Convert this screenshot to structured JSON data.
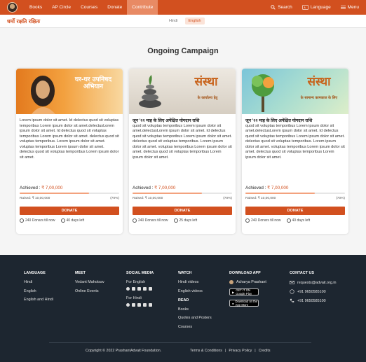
{
  "nav": {
    "items": [
      {
        "label": "Books"
      },
      {
        "label": "AP Circle"
      },
      {
        "label": "Courses"
      },
      {
        "label": "Donate"
      },
      {
        "label": "Contribute"
      }
    ],
    "search_label": "Search",
    "language_label": "Language",
    "menu_label": "Menu",
    "accent_color": "#d2501f"
  },
  "subbar": {
    "tagline": "धर्मो रक्षति रक्षितः",
    "lang_options": [
      "Hindi",
      "English"
    ],
    "selected": "English"
  },
  "page_title": "Ongoing Campaign",
  "cards": [
    {
      "banner_text": "घर-घर उपनिषद अभियान",
      "title": "",
      "desc": "Lorem ipsum dolor sit amet. Id delectus quod sit voluptas temporibus Lorem ipsum dolor sit amet.delectusLorem ipsum dolor sit amet. Id delectus quod sit voluptas temporibus Lorem ipsum dolor sit amet. delectus quod sit voluptas temporibus. Lorem ipsum dolor sit amet. voluptas temporibus Lorem ipsum dolor sit amet. delectus quod sit voluptas temporibus Lorem ipsum dolor sit amet.",
      "achieved_label": "Achieved :",
      "achieved_amount": "₹ 7,00,000",
      "raised": "Raised: ₹ 10,00,000",
      "percent_label": "(70%)",
      "progress": 0.7,
      "donate_label": "DONATE",
      "donors": "240 Donars till now",
      "days_left": "40 days left"
    },
    {
      "banner_text": "संस्था",
      "banner_sub": "के कार्यालय हेतु",
      "title": "जून '२२ माह के लिए अपेक्षित योगदान राशि",
      "desc": "quod sit voluptas temporibus Lorem ipsum dolor sit amet.delectusLorem ipsum dolor sit amet. Id delectus quod sit voluptas temporibus Lorem ipsum dolor sit amet. delectus quod sit voluptas temporibus. Lorem ipsum dolor sit amet. voluptas temporibus Lorem ipsum dolor sit amet. delectus quod sit voluptas temporibus Lorem ipsum dolor sit amet.",
      "achieved_label": "Achieved :",
      "achieved_amount": "₹ 7,00,000",
      "raised": "Raised: ₹ 10,00,000",
      "percent_label": "(70%)",
      "progress": 0.7,
      "donate_label": "DONATE",
      "donors": "240 Donars till now",
      "days_left": "25 days left"
    },
    {
      "banner_text": "संस्था",
      "banner_sub": "के सामान्य कामकाज के लिए",
      "title": "जून '२२ माह के लिए अपेक्षित योगदान राशि",
      "desc": "quod sit voluptas temporibus Lorem ipsum dolor sit amet.delectusLorem ipsum dolor sit amet. Id delectus quod sit voluptas temporibus Lorem ipsum dolor sit amet. delectus quod sit voluptas temporibus. Lorem ipsum dolor sit amet. voluptas temporibus Lorem ipsum dolor sit amet. delectus quod sit voluptas temporibus Lorem ipsum dolor sit amet.",
      "achieved_label": "Achieved :",
      "achieved_amount": "₹ 7,00,000",
      "raised": "Raised: ₹ 10,00,000",
      "percent_label": "(70%)",
      "progress": 0.7,
      "donate_label": "DONATE",
      "donors": "240 Donars till now",
      "days_left": "40 days left"
    }
  ],
  "footer": {
    "language": {
      "heading": "LANGUAGE",
      "links": [
        "Hindi",
        "English",
        "English and Hindi"
      ]
    },
    "meet": {
      "heading": "MEET",
      "links": [
        "Vedant Mahotsav",
        "Online Events"
      ]
    },
    "social": {
      "heading": "SOCIAL MEDIA",
      "for_english": "For English",
      "for_hindi": "For Hindi"
    },
    "watch": {
      "heading": "WATCH",
      "links": [
        "Hindi videos",
        "English videos"
      ]
    },
    "read": {
      "heading": "READ",
      "links": [
        "Books",
        "Quotes and Posters",
        "Courses"
      ]
    },
    "download": {
      "heading": "DOWNLOAD APP",
      "app_name": "Acharya Prashant",
      "google_play": "GET IT ON Google Play",
      "app_store": "Download on the App Store"
    },
    "contact": {
      "heading": "CONTACT US",
      "email": "requests@advait.org.in",
      "whatsapp": "+91 9650585100",
      "phone": "+91 9650585100"
    },
    "copyright": "Copyright © 2022 PrashantAdvait Foundation.",
    "legal": [
      "Terms & Conditions",
      "|",
      "Privacy Policy",
      "|",
      "Credits"
    ]
  }
}
